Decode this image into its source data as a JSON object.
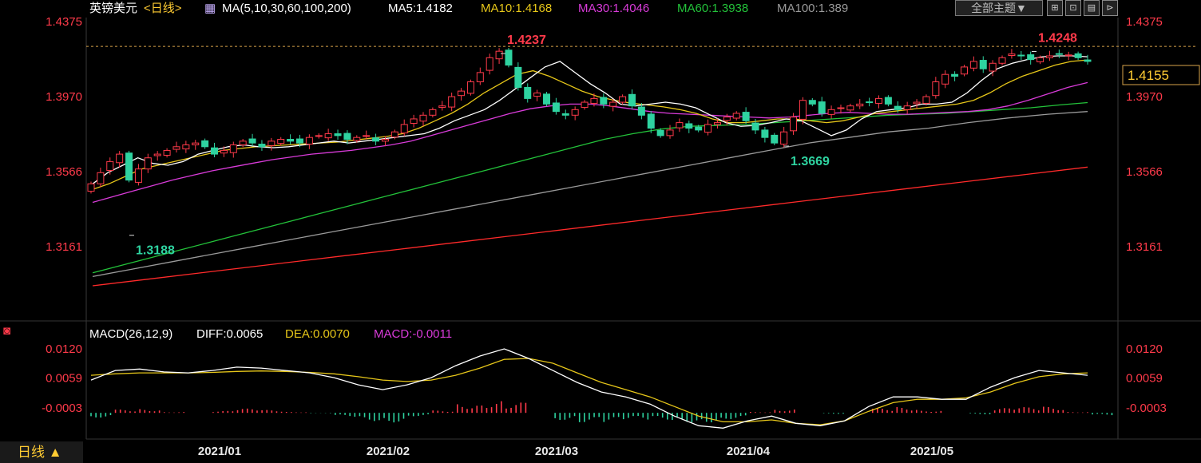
{
  "header": {
    "title": "英镑美元",
    "period_tag": "<日线>",
    "ma_label": "MA(5,10,30,60,100,200)",
    "ma5": "MA5:1.4182",
    "ma10": "MA10:1.4168",
    "ma30": "MA30:1.4046",
    "ma60": "MA60:1.3938",
    "ma100": "MA100:1.389"
  },
  "toolbar": {
    "theme_label": "全部主题▼",
    "buttons": [
      "⊞",
      "⊡",
      "▤",
      "⊳"
    ]
  },
  "macd_header": {
    "label": "MACD(26,12,9)",
    "diff": "DIFF:0.0065",
    "dea": "DEA:0.0070",
    "macd": "MACD:-0.0011"
  },
  "period_button": "日线 ▲",
  "current_price": "1.4155",
  "colors": {
    "up": "#ff3a4a",
    "down": "#2ed3a0",
    "ma5": "#ffffff",
    "ma10": "#e6c619",
    "ma30": "#d93bd9",
    "ma60": "#23c23a",
    "ma100": "#9a9a9a",
    "ma200": "#ff2a2a",
    "dea": "#e6c619",
    "macd_neg": "#d93bd9"
  },
  "chart_data": [
    {
      "type": "candlestick",
      "title": "英镑美元 <日线>",
      "x_ticks": [
        "2021/01",
        "2021/02",
        "2021/03",
        "2021/04",
        "2021/05"
      ],
      "y_ticks": [
        "1.4375",
        "1.3970",
        "1.3566",
        "1.3161"
      ],
      "ylim": [
        1.295,
        1.4375
      ],
      "annotations": [
        {
          "label": "1.4237",
          "value": 1.4237,
          "kind": "high"
        },
        {
          "label": "1.3188",
          "value": 1.3188,
          "kind": "low"
        },
        {
          "label": "1.3669",
          "value": 1.3669,
          "kind": "low"
        },
        {
          "label": "1.4248",
          "value": 1.4248,
          "kind": "high"
        }
      ],
      "close_path": [
        1.35,
        1.356,
        1.362,
        1.366,
        1.352,
        1.358,
        1.364,
        1.366,
        1.368,
        1.37,
        1.371,
        1.372,
        1.37,
        1.366,
        1.368,
        1.371,
        1.373,
        1.372,
        1.37,
        1.373,
        1.374,
        1.373,
        1.372,
        1.375,
        1.376,
        1.377,
        1.376,
        1.374,
        1.375,
        1.376,
        1.373,
        1.374,
        1.378,
        1.382,
        1.385,
        1.387,
        1.39,
        1.392,
        1.397,
        1.4,
        1.405,
        1.41,
        1.418,
        1.4215,
        1.414,
        1.402,
        1.396,
        1.399,
        1.393,
        1.389,
        1.387,
        1.39,
        1.394,
        1.396,
        1.393,
        1.394,
        1.397,
        1.392,
        1.387,
        1.38,
        1.376,
        1.379,
        1.383,
        1.38,
        1.379,
        1.382,
        1.383,
        1.386,
        1.388,
        1.384,
        1.379,
        1.375,
        1.372,
        1.378,
        1.386,
        1.395,
        1.393,
        1.388,
        1.39,
        1.391,
        1.392,
        1.393,
        1.394,
        1.396,
        1.393,
        1.39,
        1.392,
        1.394,
        1.397,
        1.405,
        1.409,
        1.408,
        1.413,
        1.416,
        1.412,
        1.415,
        1.418,
        1.42,
        1.419,
        1.417,
        1.418,
        1.419,
        1.42,
        1.4195,
        1.418,
        1.416
      ],
      "ma": {
        "MA5": [
          1.35,
          1.356,
          1.36,
          1.364,
          1.361,
          1.36,
          1.362,
          1.366,
          1.368,
          1.37,
          1.371,
          1.37,
          1.3695,
          1.37,
          1.371,
          1.372,
          1.373,
          1.372,
          1.373,
          1.374,
          1.375,
          1.376,
          1.377,
          1.38,
          1.384,
          1.387,
          1.39,
          1.395,
          1.401,
          1.407,
          1.413,
          1.416,
          1.41,
          1.404,
          1.399,
          1.393,
          1.392,
          1.393,
          1.394,
          1.393,
          1.391,
          1.387,
          1.383,
          1.381,
          1.3815,
          1.383,
          1.385,
          1.384,
          1.38,
          1.376,
          1.379,
          1.385,
          1.389,
          1.39,
          1.391,
          1.393,
          1.393,
          1.394,
          1.399,
          1.406,
          1.412,
          1.415,
          1.417,
          1.4185,
          1.419,
          1.419,
          1.4185
        ],
        "MA10": [
          1.347,
          1.35,
          1.354,
          1.358,
          1.36,
          1.362,
          1.364,
          1.366,
          1.368,
          1.369,
          1.37,
          1.3705,
          1.371,
          1.3715,
          1.372,
          1.3725,
          1.3735,
          1.3745,
          1.3755,
          1.377,
          1.38,
          1.384,
          1.388,
          1.393,
          1.399,
          1.404,
          1.409,
          1.411,
          1.408,
          1.404,
          1.4,
          1.397,
          1.395,
          1.3935,
          1.3925,
          1.3915,
          1.39,
          1.388,
          1.385,
          1.383,
          1.383,
          1.384,
          1.385,
          1.385,
          1.384,
          1.383,
          1.384,
          1.386,
          1.388,
          1.389,
          1.39,
          1.391,
          1.392,
          1.393,
          1.395,
          1.399,
          1.404,
          1.408,
          1.411,
          1.414,
          1.416,
          1.4168
        ],
        "MA30": [
          1.34,
          1.343,
          1.346,
          1.349,
          1.352,
          1.3545,
          1.357,
          1.359,
          1.361,
          1.363,
          1.3645,
          1.366,
          1.367,
          1.368,
          1.3695,
          1.371,
          1.373,
          1.376,
          1.379,
          1.382,
          1.385,
          1.388,
          1.3905,
          1.392,
          1.393,
          1.393,
          1.392,
          1.3905,
          1.389,
          1.388,
          1.3875,
          1.387,
          1.3865,
          1.386,
          1.3855,
          1.386,
          1.387,
          1.388,
          1.3885,
          1.388,
          1.3875,
          1.3875,
          1.388,
          1.3885,
          1.389,
          1.39,
          1.392,
          1.395,
          1.3985,
          1.402,
          1.4046
        ],
        "MA60": [
          1.302,
          1.306,
          1.31,
          1.314,
          1.318,
          1.322,
          1.326,
          1.33,
          1.334,
          1.338,
          1.342,
          1.346,
          1.35,
          1.354,
          1.358,
          1.362,
          1.366,
          1.37,
          1.374,
          1.377,
          1.3795,
          1.381,
          1.3815,
          1.382,
          1.383,
          1.384,
          1.385,
          1.386,
          1.387,
          1.3875,
          1.388,
          1.389,
          1.39,
          1.391,
          1.3925,
          1.3938
        ],
        "MA100": [
          1.3,
          1.304,
          1.308,
          1.312,
          1.316,
          1.32,
          1.324,
          1.328,
          1.332,
          1.336,
          1.34,
          1.344,
          1.348,
          1.352,
          1.356,
          1.36,
          1.364,
          1.368,
          1.372,
          1.375,
          1.378,
          1.38,
          1.383,
          1.3855,
          1.3875,
          1.389
        ],
        "MA200": [
          1.295,
          1.299,
          1.303,
          1.307,
          1.311,
          1.315,
          1.319,
          1.323,
          1.327,
          1.331,
          1.335,
          1.339,
          1.343,
          1.347,
          1.351,
          1.355,
          1.359
        ]
      }
    },
    {
      "type": "line",
      "title": "MACD(26,12,9)",
      "y_ticks": [
        "0.0120",
        "0.0059",
        "-0.0003"
      ],
      "ylim": [
        -0.0065,
        0.0135
      ],
      "series": [
        {
          "name": "DIFF",
          "values": [
            0.0055,
            0.0075,
            0.0078,
            0.0072,
            0.007,
            0.0075,
            0.0082,
            0.008,
            0.0075,
            0.007,
            0.006,
            0.0045,
            0.0035,
            0.0045,
            0.006,
            0.0085,
            0.0105,
            0.012,
            0.01,
            0.0075,
            0.005,
            0.003,
            0.002,
            0.0005,
            -0.002,
            -0.004,
            -0.0045,
            -0.003,
            -0.002,
            -0.0035,
            -0.004,
            -0.003,
            0.0,
            0.002,
            0.002,
            0.0015,
            0.0015,
            0.004,
            0.006,
            0.0075,
            0.007,
            0.0065
          ]
        },
        {
          "name": "DEA",
          "values": [
            0.0065,
            0.0068,
            0.007,
            0.007,
            0.007,
            0.0071,
            0.0073,
            0.0074,
            0.0073,
            0.0071,
            0.0068,
            0.0062,
            0.0055,
            0.0052,
            0.0055,
            0.0065,
            0.008,
            0.0098,
            0.01,
            0.009,
            0.007,
            0.005,
            0.0035,
            0.002,
            0.0,
            -0.002,
            -0.0032,
            -0.0032,
            -0.0028,
            -0.0035,
            -0.0038,
            -0.003,
            -0.001,
            0.0008,
            0.0015,
            0.0015,
            0.0018,
            0.003,
            0.0048,
            0.0062,
            0.0068,
            0.007
          ]
        }
      ],
      "histogram": [
        -0.001,
        0.0007,
        0.0008,
        0.0002,
        0.0,
        0.0004,
        0.0009,
        0.0006,
        0.0002,
        -0.0001,
        -0.0008,
        -0.0017,
        -0.002,
        -0.0007,
        0.0005,
        0.002,
        0.0025,
        0.0022,
        0.0,
        -0.0015,
        -0.002,
        -0.002,
        -0.0015,
        -0.0015,
        -0.002,
        -0.002,
        -0.0013,
        0.0002,
        0.0008,
        0.0,
        -0.0002,
        0.0,
        0.001,
        0.0012,
        0.0005,
        0.0,
        -0.0003,
        0.001,
        0.0012,
        0.0013,
        0.0002,
        -0.0005
      ]
    }
  ]
}
